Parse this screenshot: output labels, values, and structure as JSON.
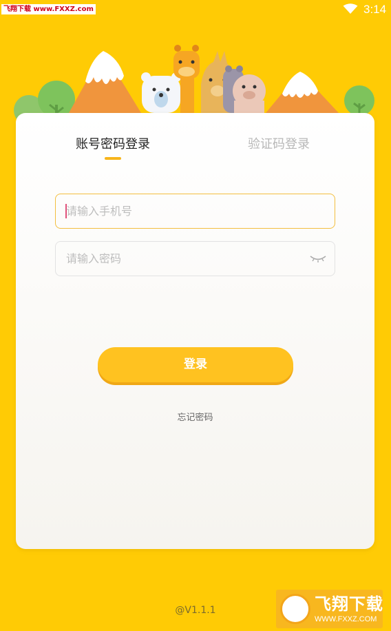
{
  "status_bar": {
    "time": "3:14",
    "watermark_top": "飞翔下载 www.FXXZ.com"
  },
  "login": {
    "tabs": [
      {
        "label": "账号密码登录",
        "active": true
      },
      {
        "label": "验证码登录",
        "active": false
      }
    ],
    "phone_input": {
      "value": "",
      "placeholder": "请输入手机号"
    },
    "password_input": {
      "value": "",
      "placeholder": "请输入密码"
    },
    "login_button": "登录",
    "forgot_password": "忘记密码"
  },
  "footer": {
    "version": "@V1.1.1"
  },
  "watermark_bottom": {
    "brand": "飞翔下载",
    "url": "WWW.FXXZ.COM"
  },
  "colors": {
    "background": "#FFCB05",
    "accent": "#F7B51B",
    "button": "#FFC220"
  },
  "icons": {
    "wifi": "wifi-icon",
    "password_visibility": "eye-closed-icon"
  }
}
